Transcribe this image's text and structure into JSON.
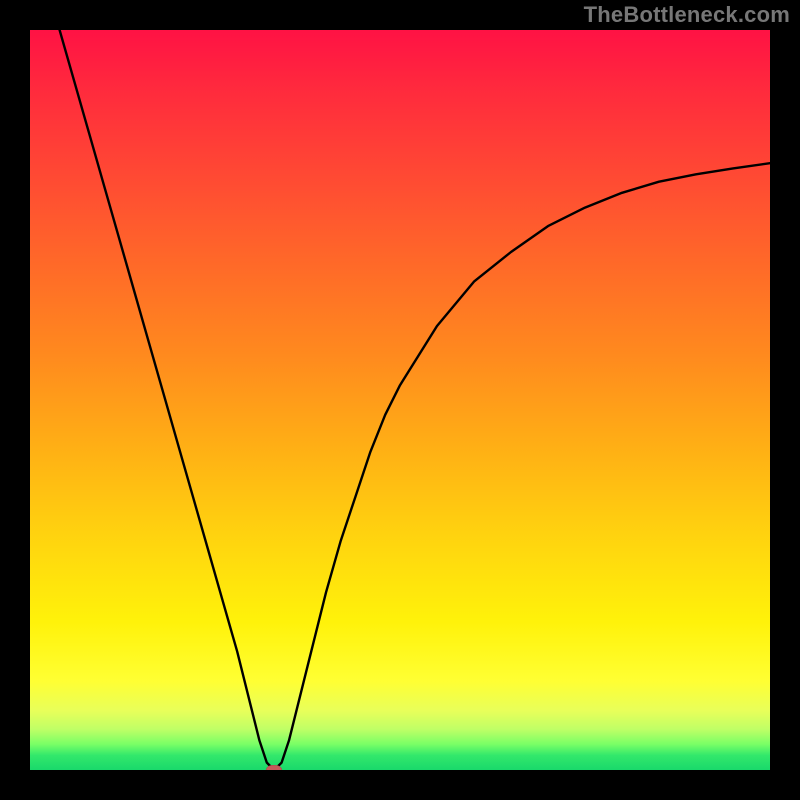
{
  "watermark": "TheBottleneck.com",
  "chart_data": {
    "type": "line",
    "title": "",
    "xlabel": "",
    "ylabel": "",
    "xlim": [
      0,
      100
    ],
    "ylim": [
      0,
      100
    ],
    "grid": false,
    "series": [
      {
        "name": "curve",
        "x": [
          4,
          6,
          8,
          10,
          12,
          14,
          16,
          18,
          20,
          22,
          24,
          26,
          28,
          30,
          31,
          32,
          33,
          34,
          35,
          36,
          38,
          40,
          42,
          44,
          46,
          48,
          50,
          55,
          60,
          65,
          70,
          75,
          80,
          85,
          90,
          95,
          100
        ],
        "y": [
          100,
          93,
          86,
          79,
          72,
          65,
          58,
          51,
          44,
          37,
          30,
          23,
          16,
          8,
          4,
          1,
          0,
          1,
          4,
          8,
          16,
          24,
          31,
          37,
          43,
          48,
          52,
          60,
          66,
          70,
          73.5,
          76,
          78,
          79.5,
          80.5,
          81.3,
          82
        ]
      }
    ],
    "marker": {
      "x": 33,
      "y": 0,
      "color": "#c65a5a"
    },
    "annotations": []
  },
  "colors": {
    "frame": "#000000",
    "curve": "#000000",
    "marker": "#c65a5a",
    "gradient_top": "#ff1244",
    "gradient_bottom": "#19d96b"
  }
}
